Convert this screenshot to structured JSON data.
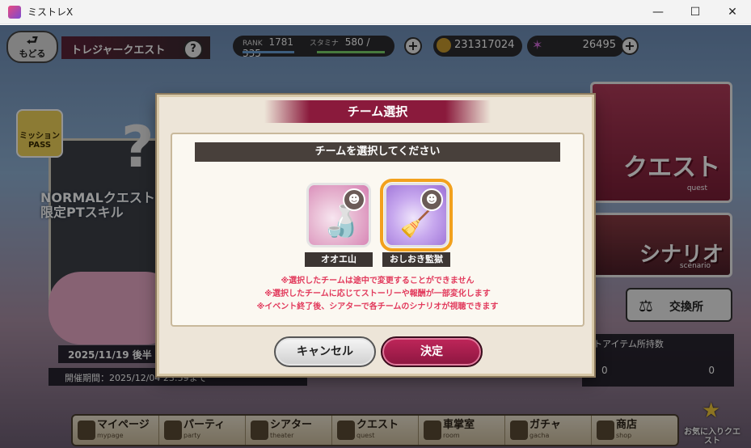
{
  "window": {
    "title": "ミストレX",
    "minimize": "—",
    "maximize": "☐",
    "close": "✕"
  },
  "header": {
    "back_label": "もどる",
    "back_arrow": "⮐",
    "title": "トレジャークエスト",
    "help": "?"
  },
  "status": {
    "rank_label": "RANK",
    "rank_value": "1781",
    "stamina_label": "スタミナ",
    "stamina_value": "580 / 335",
    "coins": "231317024",
    "stars": "26495",
    "plus": "+"
  },
  "background": {
    "question": "?",
    "mission_pass": "ミッション PASS",
    "normal_quest_line1": "NORMALクエスト",
    "normal_quest_line2": "限定PTスキル",
    "event_date": "2025/11/19 後半",
    "event_period": "開催期間：2025/12/04 23:59まで"
  },
  "side": {
    "quest_label": "クエスト",
    "quest_sub": "quest",
    "scenario_label": "シナリオ",
    "scenario_sub": "scenario",
    "exchange_label": "交換所",
    "items_label": "トアイテム所持数",
    "item_count_1": "0",
    "item_count_2": "0"
  },
  "nav": {
    "items": [
      {
        "label": "マイページ",
        "sub": "mypage"
      },
      {
        "label": "パーティ",
        "sub": "party"
      },
      {
        "label": "シアター",
        "sub": "theater"
      },
      {
        "label": "クエスト",
        "sub": "quest"
      },
      {
        "label": "車掌室",
        "sub": "room"
      },
      {
        "label": "ガチャ",
        "sub": "gacha"
      },
      {
        "label": "商店",
        "sub": "shop"
      }
    ],
    "favorite_label": "お気に入りクエスト"
  },
  "dialog": {
    "title": "チーム選択",
    "prompt": "チームを選択してください",
    "teams": [
      {
        "name": "オオエ山",
        "selected": false
      },
      {
        "name": "おしおき監獄",
        "selected": true
      }
    ],
    "notes": [
      "※選択したチームは途中で変更することができません",
      "※選択したチームに応じてストーリーや報酬が一部変化します",
      "※イベント終了後、シアターで各チームのシナリオが視聴できます"
    ],
    "cancel_label": "キャンセル",
    "ok_label": "決定"
  }
}
